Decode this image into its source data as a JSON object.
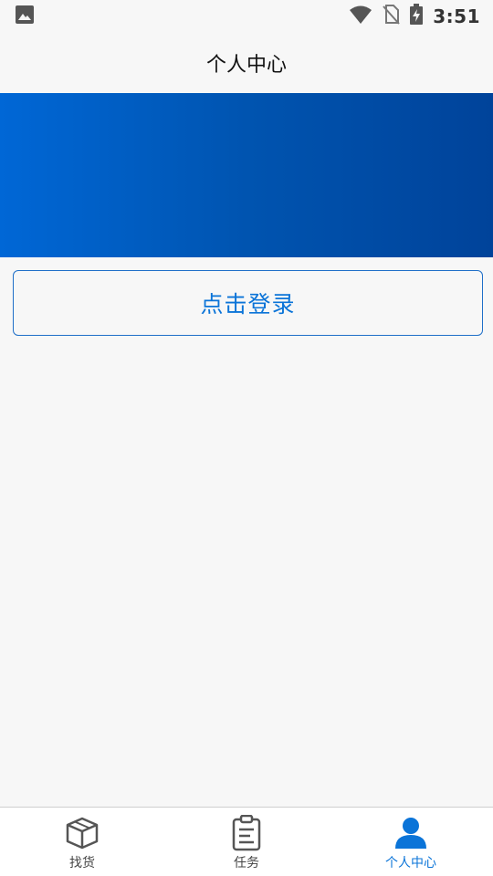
{
  "status_bar": {
    "time": "3:51",
    "icons": [
      "image-icon",
      "wifi-icon",
      "no-sim-icon",
      "battery-charging-icon"
    ]
  },
  "header": {
    "title": "个人中心"
  },
  "login": {
    "label": "点击登录"
  },
  "bottom_nav": {
    "items": [
      {
        "label": "找货",
        "icon": "box-icon",
        "active": false
      },
      {
        "label": "任务",
        "icon": "clipboard-icon",
        "active": false
      },
      {
        "label": "个人中心",
        "icon": "person-icon",
        "active": true
      }
    ]
  },
  "colors": {
    "accent": "#0b74d8",
    "banner_start": "#0067d6",
    "banner_end": "#00439a",
    "background": "#f7f7f7"
  }
}
